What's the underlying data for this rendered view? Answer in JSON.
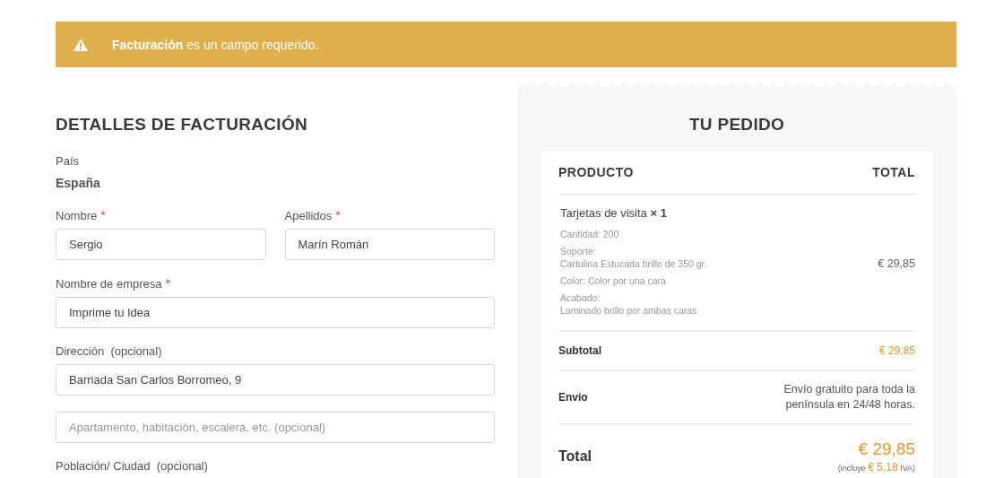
{
  "alert": {
    "message": "**Facturación** es un campo requerido."
  },
  "billing": {
    "title": "DETALLES DE FACTURACIÓN",
    "required_mark": "*",
    "country": {
      "label": "País",
      "value": "España"
    },
    "rows": [
      [
        {
          "label": "Nombre",
          "required": true,
          "value": "Sergio"
        },
        {
          "label": "Apellidos",
          "required": true,
          "value": "Marín Román"
        }
      ],
      [
        {
          "label": "Nombre de empresa",
          "required": true,
          "value": "Imprime tu Idea"
        }
      ],
      [
        {
          "label": "Dirección  (opcional)",
          "required": false,
          "value": "Barriada San Carlos Borromeo, 9"
        }
      ],
      [
        {
          "placeholder": "Apartamento, habitación, escalera, etc. (opcional)"
        }
      ],
      [
        {
          "label": "Población/ Ciudad  (opcional)",
          "required": false
        }
      ]
    ]
  },
  "order": {
    "title": "TU PEDIDO",
    "columns": [
      "PRODUCTO",
      "TOTAL"
    ],
    "item": {
      "name": "Tarjetas de visita",
      "quantity": "× 1",
      "price": "€ 29,85",
      "details": [
        "Cantidad: 200",
        "Soporte:\nCartulina Estucada brillo de 350 gr.",
        "Color: Color por una cara",
        "Acabado:\nLaminado brillo por ambas caras"
      ]
    },
    "subtotal": {
      "label": "Subtotal",
      "value": "€ 29,85"
    },
    "shipping": {
      "label": "Envío",
      "value": "Envío gratuito para toda la península en 24/48 horas."
    },
    "total": {
      "label": "Total",
      "value": "€ 29,85",
      "tax_note": "(incluye **€ 5,18** IVA)"
    }
  }
}
